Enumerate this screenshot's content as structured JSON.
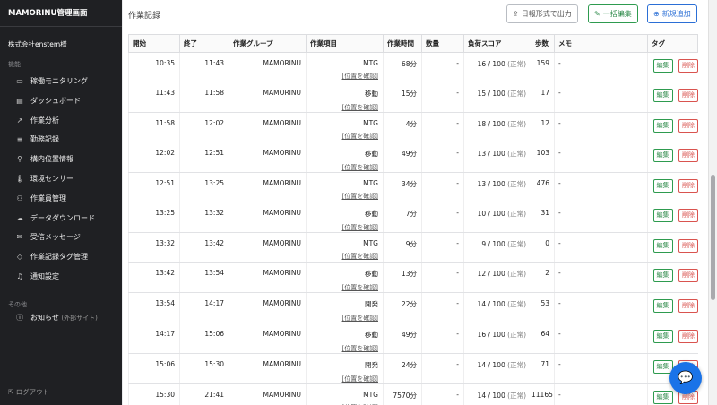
{
  "sidebar": {
    "title": "MAMORINU管理画面",
    "company": "株式会社enstem様",
    "section_features": "機能",
    "items": [
      {
        "label": "稼働モニタリング",
        "icon": "monitor-icon",
        "glyph": "▭"
      },
      {
        "label": "ダッシュボード",
        "icon": "dashboard-icon",
        "glyph": "▤"
      },
      {
        "label": "作業分析",
        "icon": "analytics-icon",
        "glyph": "↗"
      },
      {
        "label": "勤務記録",
        "icon": "list-icon",
        "glyph": "≡"
      },
      {
        "label": "構内位置情報",
        "icon": "person-pin-icon",
        "glyph": "⚲"
      },
      {
        "label": "環境センサー",
        "icon": "thermometer-icon",
        "glyph": "🌡"
      },
      {
        "label": "作業員管理",
        "icon": "group-icon",
        "glyph": "⚇"
      },
      {
        "label": "データダウンロード",
        "icon": "cloud-download-icon",
        "glyph": "☁"
      },
      {
        "label": "受信メッセージ",
        "icon": "inbox-icon",
        "glyph": "✉"
      },
      {
        "label": "作業記録タグ管理",
        "icon": "tag-icon",
        "glyph": "◇"
      },
      {
        "label": "通知設定",
        "icon": "bell-icon",
        "glyph": "♫"
      }
    ],
    "section_other": "その他",
    "news_label": "お知らせ",
    "news_sub": "(外部サイト)",
    "news_glyph": "ⓘ",
    "logout": "ログアウト"
  },
  "header": {
    "page_title": "作業記録",
    "btn_export": "日報形式で出力",
    "btn_bulk_edit": "一括編集",
    "btn_new": "新規追加"
  },
  "table": {
    "headers": [
      "開始",
      "終了",
      "作業グループ",
      "作業項目",
      "作業時間",
      "数量",
      "負荷スコア",
      "歩数",
      "メモ",
      "タグ",
      ""
    ],
    "location_link": "[位置を確認]",
    "edit_label": "編集",
    "delete_label": "削除",
    "rows": [
      {
        "start": "10:35",
        "end": "11:43",
        "group": "MAMORINU",
        "item": "MTG",
        "duration": "68分",
        "qty": "-",
        "score": "16 / 100",
        "status": "(正常)",
        "steps": "159",
        "memo": "-"
      },
      {
        "start": "11:43",
        "end": "11:58",
        "group": "MAMORINU",
        "item": "移動",
        "duration": "15分",
        "qty": "-",
        "score": "15 / 100",
        "status": "(正常)",
        "steps": "17",
        "memo": "-"
      },
      {
        "start": "11:58",
        "end": "12:02",
        "group": "MAMORINU",
        "item": "MTG",
        "duration": "4分",
        "qty": "-",
        "score": "18 / 100",
        "status": "(正常)",
        "steps": "12",
        "memo": "-"
      },
      {
        "start": "12:02",
        "end": "12:51",
        "group": "MAMORINU",
        "item": "移動",
        "duration": "49分",
        "qty": "-",
        "score": "13 / 100",
        "status": "(正常)",
        "steps": "103",
        "memo": "-"
      },
      {
        "start": "12:51",
        "end": "13:25",
        "group": "MAMORINU",
        "item": "MTG",
        "duration": "34分",
        "qty": "-",
        "score": "13 / 100",
        "status": "(正常)",
        "steps": "476",
        "memo": "-"
      },
      {
        "start": "13:25",
        "end": "13:32",
        "group": "MAMORINU",
        "item": "移動",
        "duration": "7分",
        "qty": "-",
        "score": "10 / 100",
        "status": "(正常)",
        "steps": "31",
        "memo": "-"
      },
      {
        "start": "13:32",
        "end": "13:42",
        "group": "MAMORINU",
        "item": "MTG",
        "duration": "9分",
        "qty": "-",
        "score": "9 / 100",
        "status": "(正常)",
        "steps": "0",
        "memo": "-"
      },
      {
        "start": "13:42",
        "end": "13:54",
        "group": "MAMORINU",
        "item": "移動",
        "duration": "13分",
        "qty": "-",
        "score": "12 / 100",
        "status": "(正常)",
        "steps": "2",
        "memo": "-"
      },
      {
        "start": "13:54",
        "end": "14:17",
        "group": "MAMORINU",
        "item": "開発",
        "duration": "22分",
        "qty": "-",
        "score": "14 / 100",
        "status": "(正常)",
        "steps": "53",
        "memo": "-"
      },
      {
        "start": "14:17",
        "end": "15:06",
        "group": "MAMORINU",
        "item": "移動",
        "duration": "49分",
        "qty": "-",
        "score": "16 / 100",
        "status": "(正常)",
        "steps": "64",
        "memo": "-"
      },
      {
        "start": "15:06",
        "end": "15:30",
        "group": "MAMORINU",
        "item": "開発",
        "duration": "24分",
        "qty": "-",
        "score": "14 / 100",
        "status": "(正常)",
        "steps": "71",
        "memo": "-"
      },
      {
        "start": "15:30",
        "end": "21:41",
        "group": "MAMORINU",
        "item": "MTG",
        "duration": "7570分",
        "qty": "-",
        "score": "14 / 100",
        "status": "(正常)",
        "steps": "11165",
        "memo": "-"
      }
    ]
  },
  "chat_glyph": "💬"
}
